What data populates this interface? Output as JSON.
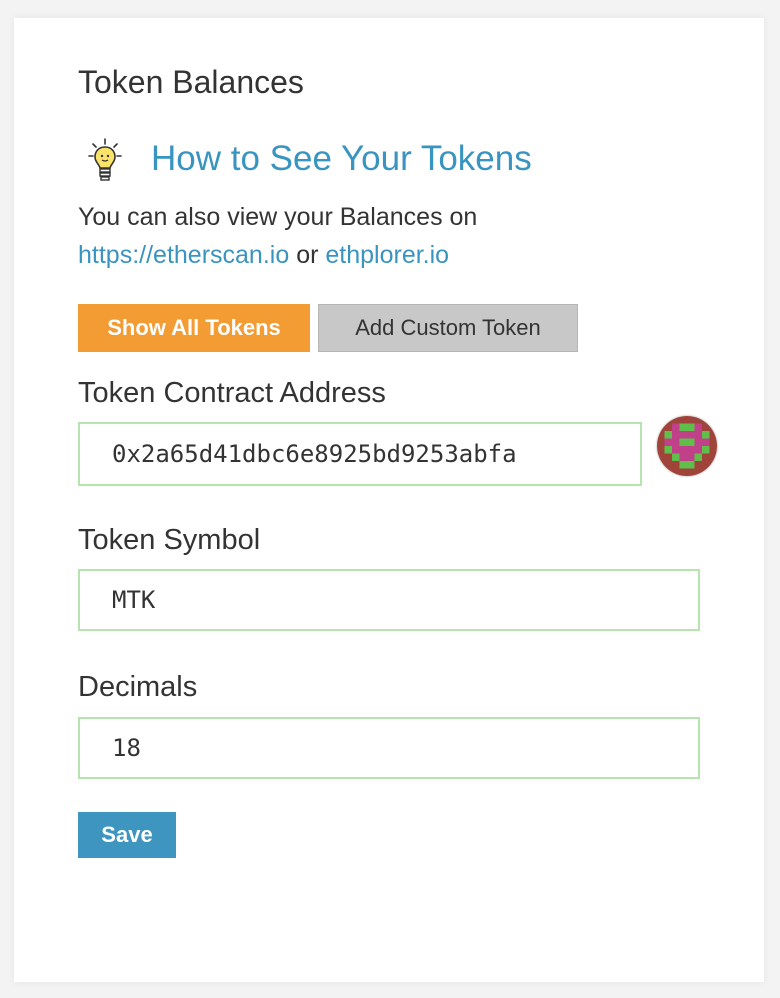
{
  "section": {
    "title": "Token Balances"
  },
  "help": {
    "icon": "lightbulb-icon",
    "link_text": "How to See Your Tokens",
    "description_prefix": "You can also view your Balances on",
    "etherscan_link": "https://etherscan.io",
    "or_text": "or",
    "ethplorer_link": "ethplorer.io"
  },
  "buttons": {
    "show_all": "Show All Tokens",
    "add_custom": "Add Custom Token",
    "save": "Save"
  },
  "form": {
    "contract_address_label": "Token Contract Address",
    "contract_address_value": "0x2a65d41dbc6e8925bd9253abfa",
    "symbol_label": "Token Symbol",
    "symbol_value": "MTK",
    "decimals_label": "Decimals",
    "decimals_value": "18",
    "identicon": "address-identicon"
  },
  "colors": {
    "accent_orange": "#f39c33",
    "link_blue": "#3a94c0",
    "save_blue": "#3e95bf",
    "valid_border": "#b6e3b0"
  }
}
